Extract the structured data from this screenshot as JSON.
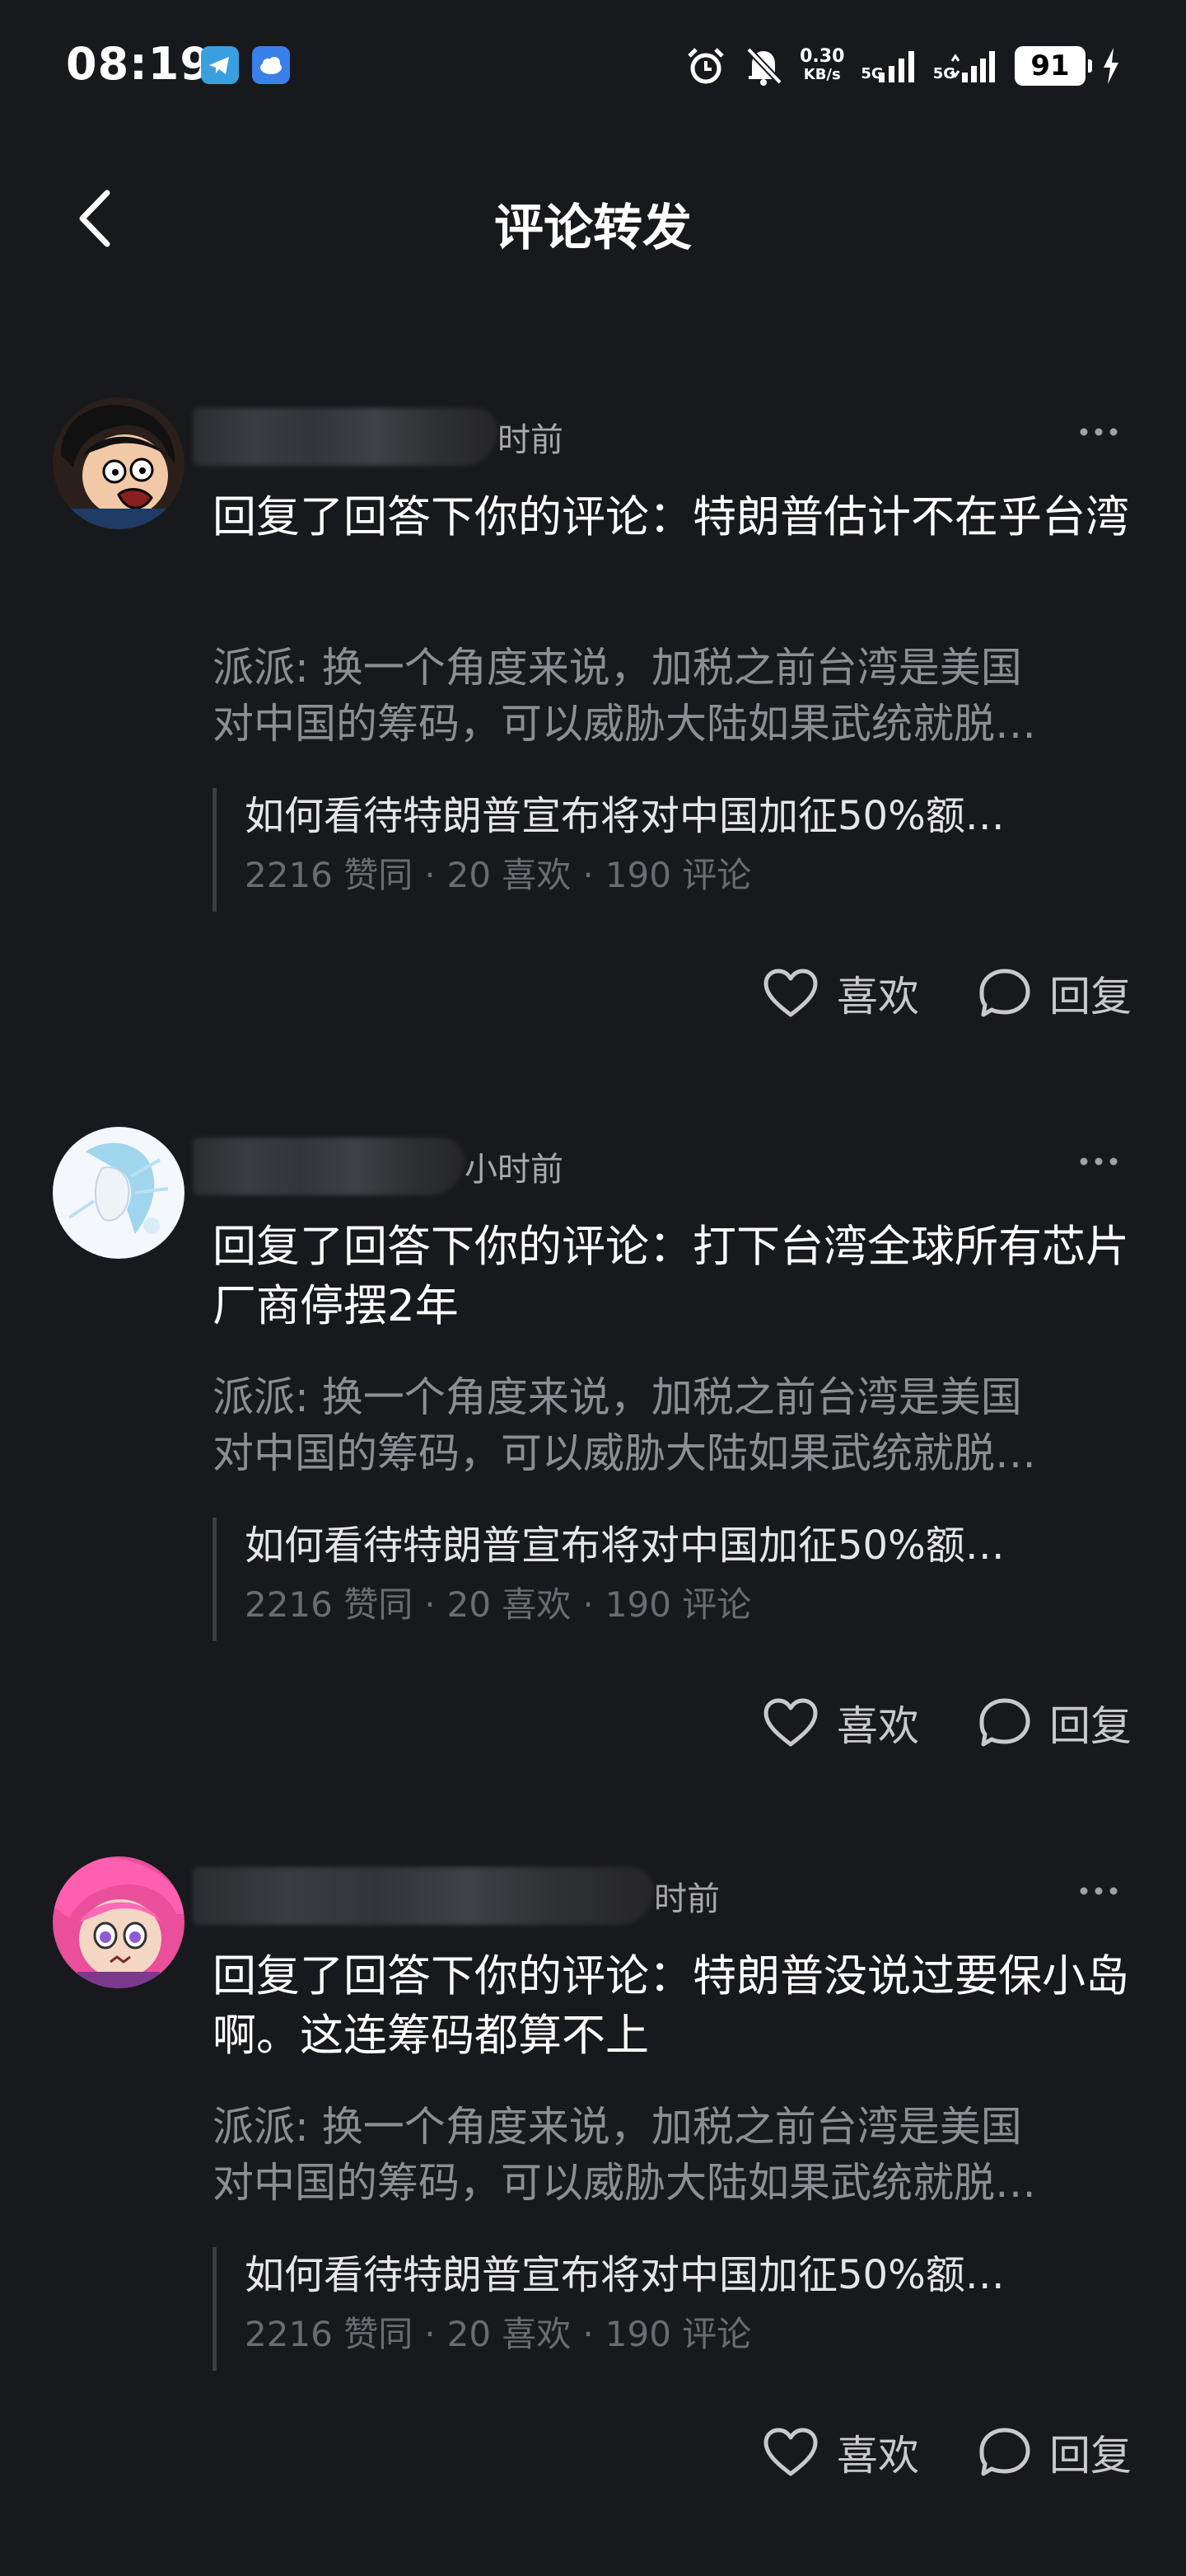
{
  "status_bar": {
    "time": "08:19",
    "net_speed_value": "0.30",
    "net_speed_unit": "KB/s",
    "signal1_label": "5G",
    "signal2_label": "5G",
    "battery": "91",
    "icons": [
      "telegram-icon",
      "cloud-icon",
      "alarm-icon",
      "mute-icon",
      "signal-icon",
      "signal-icon",
      "battery-icon",
      "charging-icon"
    ]
  },
  "header": {
    "title": "评论转发",
    "back_icon": "chevron-left-icon"
  },
  "items": [
    {
      "time_ago": "时前",
      "reply": "回复了回答下你的评论：特朗普估计不在乎台湾",
      "quote_line1": "派派: 换一个角度来说，加税之前台湾是美国",
      "quote_line2": "对中国的筹码，可以威胁大陆如果武统就脱…",
      "question_title": "如何看待特朗普宣布将对中国加征50%额…",
      "stat_agree": "2216 赞同",
      "stat_like": "20 喜欢",
      "stat_comment": "190 评论",
      "like_label": "喜欢",
      "reply_label": "回复"
    },
    {
      "time_ago": "小时前",
      "reply": "回复了回答下你的评论：打下台湾全球所有芯片厂商停摆2年",
      "quote_line1": "派派: 换一个角度来说，加税之前台湾是美国",
      "quote_line2": "对中国的筹码，可以威胁大陆如果武统就脱…",
      "question_title": "如何看待特朗普宣布将对中国加征50%额…",
      "stat_agree": "2216 赞同",
      "stat_like": "20 喜欢",
      "stat_comment": "190 评论",
      "like_label": "喜欢",
      "reply_label": "回复"
    },
    {
      "time_ago": "时前",
      "reply": "回复了回答下你的评论：特朗普没说过要保小岛啊。这连筹码都算不上",
      "quote_line1": "派派: 换一个角度来说，加税之前台湾是美国",
      "quote_line2": "对中国的筹码，可以威胁大陆如果武统就脱…",
      "question_title": "如何看待特朗普宣布将对中国加征50%额…",
      "stat_agree": "2216 赞同",
      "stat_like": "20 喜欢",
      "stat_comment": "190 评论",
      "like_label": "喜欢",
      "reply_label": "回复"
    }
  ]
}
